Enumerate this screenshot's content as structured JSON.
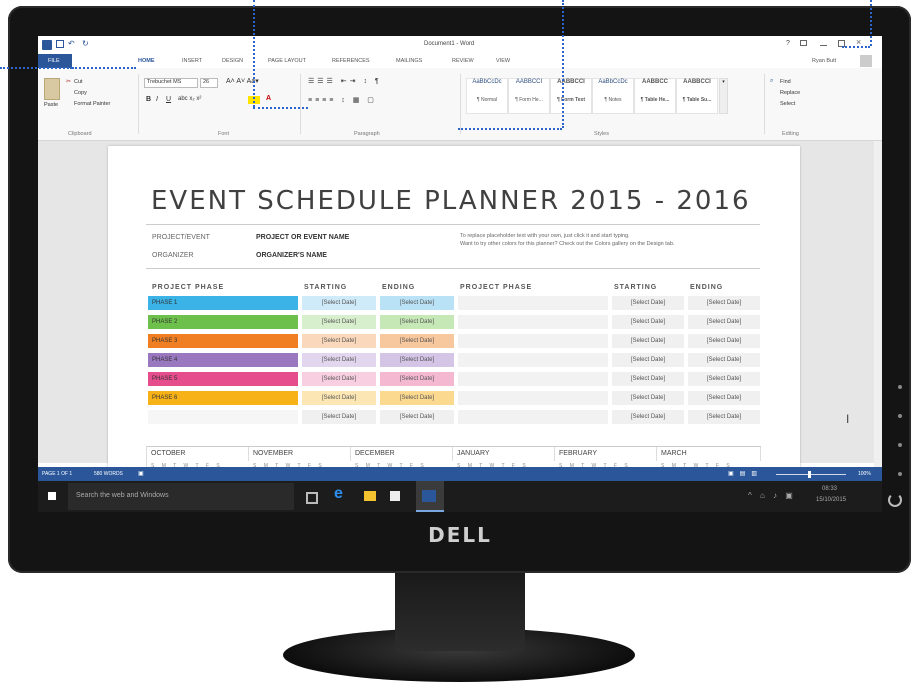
{
  "window": {
    "title": "Document1 - Word",
    "user": "Ryan Butt",
    "help": "?"
  },
  "tabs": [
    "FILE",
    "HOME",
    "INSERT",
    "DESIGN",
    "PAGE LAYOUT",
    "REFERENCES",
    "MAILINGS",
    "REVIEW",
    "VIEW"
  ],
  "ribbon": {
    "clipboard": {
      "paste": "Paste",
      "cut": "Cut",
      "copy": "Copy",
      "format_painter": "Format Painter",
      "label": "Clipboard"
    },
    "font": {
      "name": "Trebuchet MS",
      "size": "26",
      "label": "Font"
    },
    "paragraph": {
      "label": "Paragraph"
    },
    "styles": {
      "label": "Styles",
      "items": [
        {
          "sample": "AaBbCcDc",
          "name": "¶ Normal"
        },
        {
          "sample": "AABBCCI",
          "name": "¶ Form He..."
        },
        {
          "sample": "AABBCCI",
          "name": "¶ Form Text"
        },
        {
          "sample": "AaBbCcDc",
          "name": "¶ Notes"
        },
        {
          "sample": "AABBCC",
          "name": "¶ Table He..."
        },
        {
          "sample": "AABBCCI",
          "name": "¶ Table Su..."
        }
      ]
    },
    "editing": {
      "find": "Find",
      "replace": "Replace",
      "select": "Select",
      "label": "Editing"
    }
  },
  "document": {
    "title": "EVENT SCHEDULE PLANNER 2015 - 2016",
    "project_label": "PROJECT/EVENT",
    "project_value": "PROJECT OR EVENT NAME",
    "organizer_label": "ORGANIZER",
    "organizer_value": "ORGANIZER'S NAME",
    "hint1": "To replace placeholder text with your own, just click it and start typing.",
    "hint2": "Want to try other colors for this planner? Check out the Colors gallery on the Design tab.",
    "headers": {
      "phase": "PROJECT PHASE",
      "starting": "STARTING",
      "ending": "ENDING"
    },
    "select_date": "[Select Date]",
    "phases": [
      {
        "label": "PHASE 1",
        "color": "#3bb3e6",
        "start_bg": "#cfeaf8",
        "end_bg": "#b9e2f6"
      },
      {
        "label": "PHASE 2",
        "color": "#6dc04b",
        "start_bg": "#d8efcd",
        "end_bg": "#c6e8b6"
      },
      {
        "label": "PHASE 3",
        "color": "#ef7f22",
        "start_bg": "#fad8bb",
        "end_bg": "#f7c79d"
      },
      {
        "label": "PHASE 4",
        "color": "#9a78c0",
        "start_bg": "#e2d6ee",
        "end_bg": "#d4c4e6"
      },
      {
        "label": "PHASE 5",
        "color": "#e64d8c",
        "start_bg": "#f8cfe0",
        "end_bg": "#f4b9d1"
      },
      {
        "label": "PHASE 6",
        "color": "#f7b218",
        "start_bg": "#fce6b4",
        "end_bg": "#fbd98f"
      }
    ],
    "months": [
      "OCTOBER",
      "NOVEMBER",
      "DECEMBER",
      "JANUARY",
      "FEBRUARY",
      "MARCH"
    ],
    "weekdays": "S M T W T F S"
  },
  "status": {
    "page": "PAGE 1 OF 1",
    "words": "580 WORDS",
    "zoom": "100%"
  },
  "taskbar": {
    "search_placeholder": "Search the web and Windows",
    "time": "08:33",
    "date": "15/10/2015"
  },
  "brand": "DELL"
}
